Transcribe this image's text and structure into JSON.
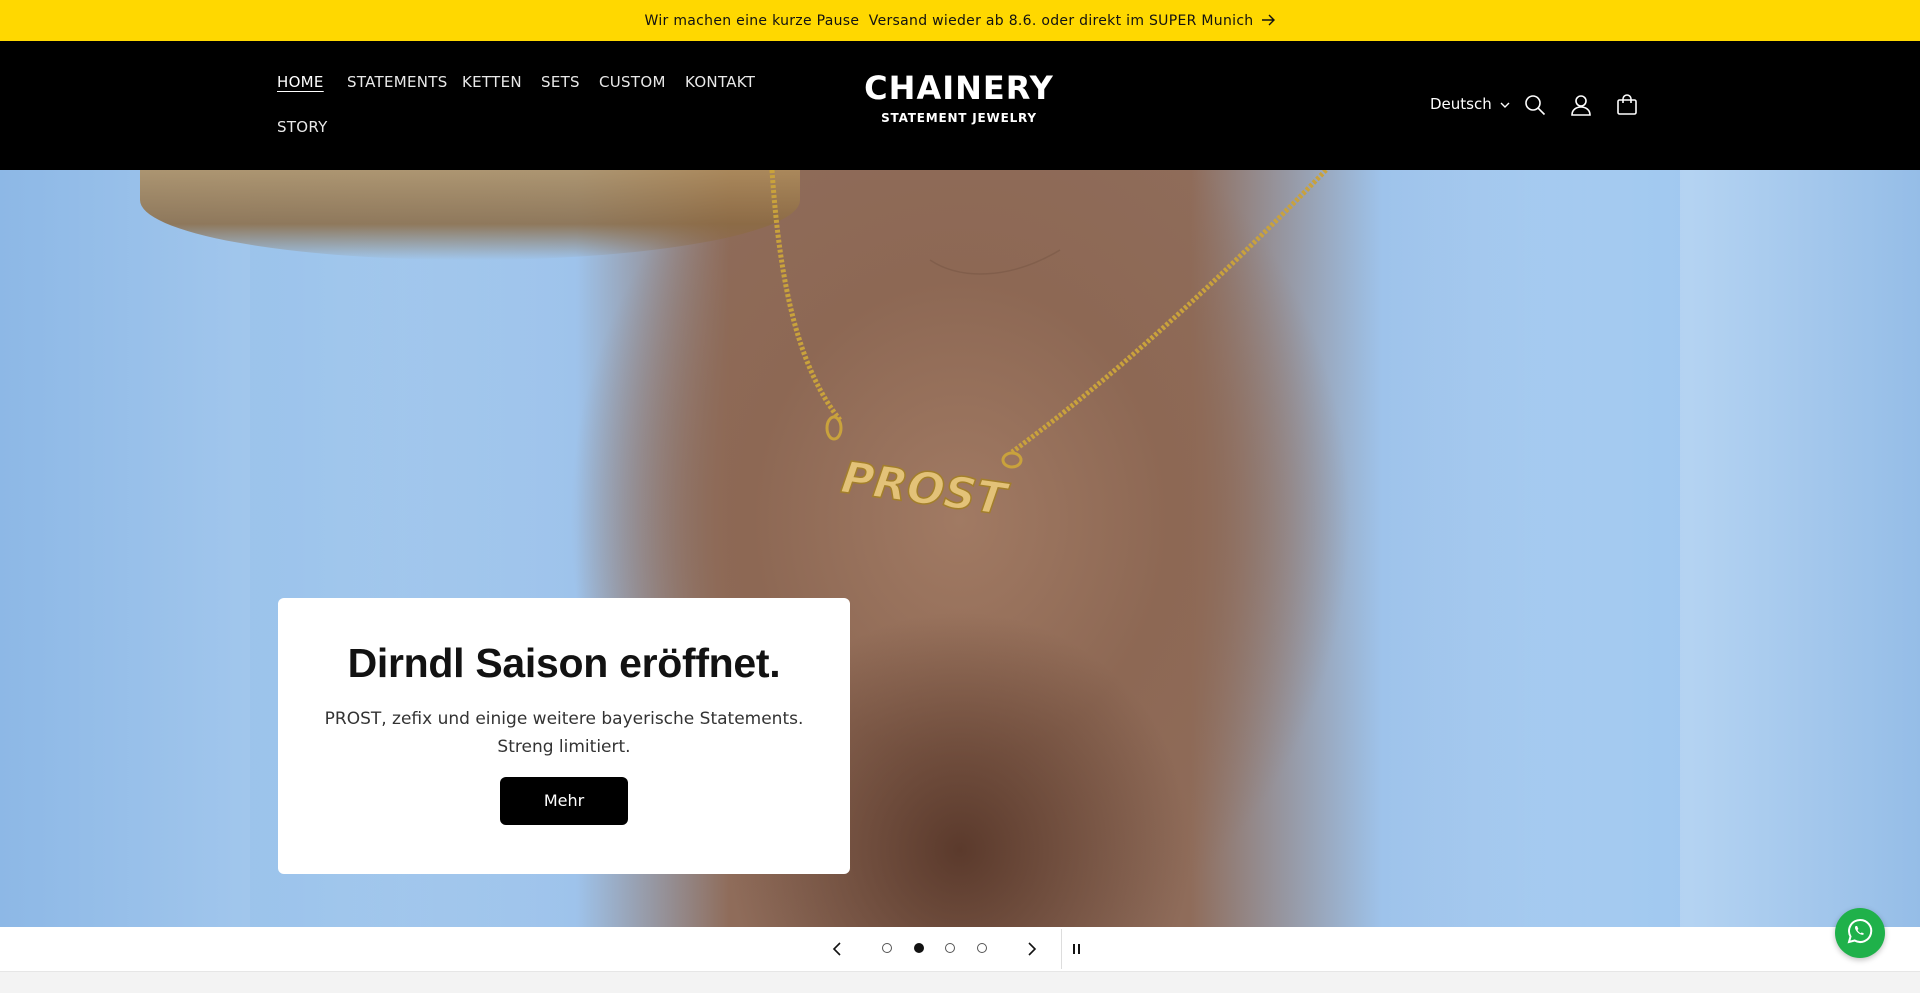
{
  "announcement": {
    "text": "Wir machen eine kurze Pause ⁠ Versand wieder ab 8.6. oder direkt im SUPER Munich",
    "arrow_icon": "arrow-right-icon"
  },
  "nav": {
    "items": [
      {
        "label": "HOME",
        "active": true
      },
      {
        "label": "STATEMENTS"
      },
      {
        "label": "KETTEN"
      },
      {
        "label": "SETS"
      },
      {
        "label": "CUSTOM"
      },
      {
        "label": "KONTAKT"
      },
      {
        "label": "STORY"
      }
    ]
  },
  "logo": {
    "name": "CHAINERY",
    "tagline": "STATEMENT JEWELRY"
  },
  "header": {
    "language": "Deutsch",
    "icons": [
      "search-icon",
      "account-icon",
      "cart-icon"
    ]
  },
  "hero": {
    "pendant_text": "PROST",
    "heading": "Dirndl Saison eröffnet.",
    "text": "PROST, zefix und einige weitere bayerische Statements. Streng limitiert.",
    "button_label": "Mehr"
  },
  "slider": {
    "slide_count": 4,
    "active_slide": 2
  },
  "colors": {
    "announcement_bg": "#ffd800",
    "header_bg": "#000000",
    "button_bg": "#000000",
    "whatsapp": "#1fb14a"
  }
}
